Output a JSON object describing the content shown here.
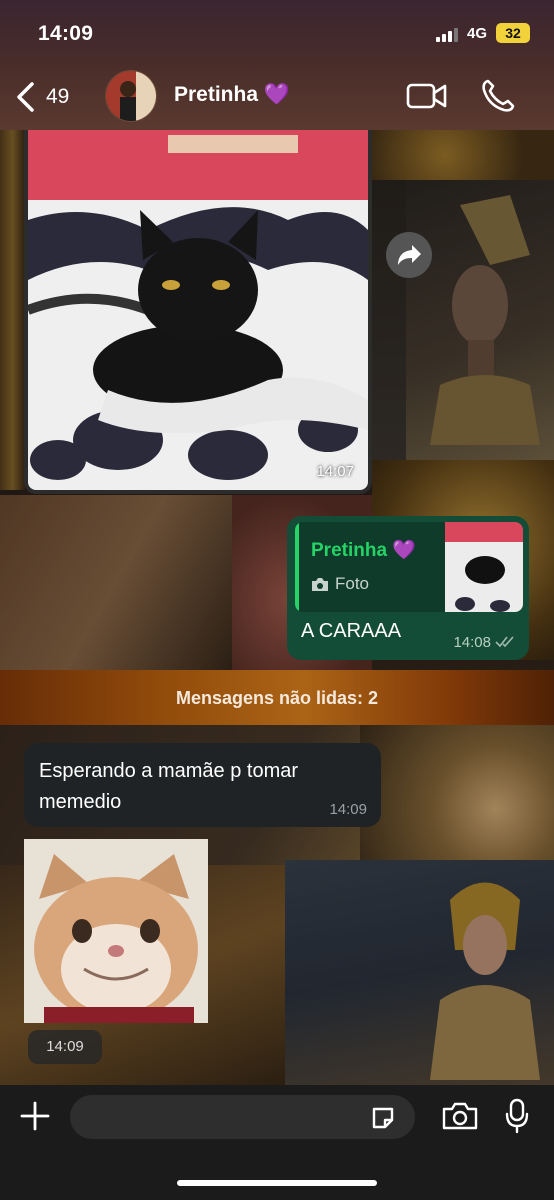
{
  "status_bar": {
    "time": "14:09",
    "network": "4G",
    "battery": "32"
  },
  "header": {
    "back_count": "49",
    "contact_name": "Pretinha 💜",
    "icons": [
      "chevron-left-icon",
      "video-icon",
      "phone-icon"
    ]
  },
  "messages": {
    "photo_in": {
      "time": "14:07"
    },
    "reply_out": {
      "quoted_name": "Pretinha 💜",
      "quoted_type": "Foto",
      "text": "A CARAAA",
      "time": "14:08"
    },
    "unread_banner": "Mensagens não lidas: 2",
    "text_in": {
      "text": "Esperando a mamãe p tomar memedio",
      "time": "14:09"
    },
    "sticker_in": {
      "time": "14:09"
    }
  },
  "input_bar": {
    "placeholder": "",
    "value": ""
  },
  "colors": {
    "accent_green": "#25d366",
    "outgoing_bubble": "#144d37",
    "incoming_bubble": "#1f2326"
  }
}
